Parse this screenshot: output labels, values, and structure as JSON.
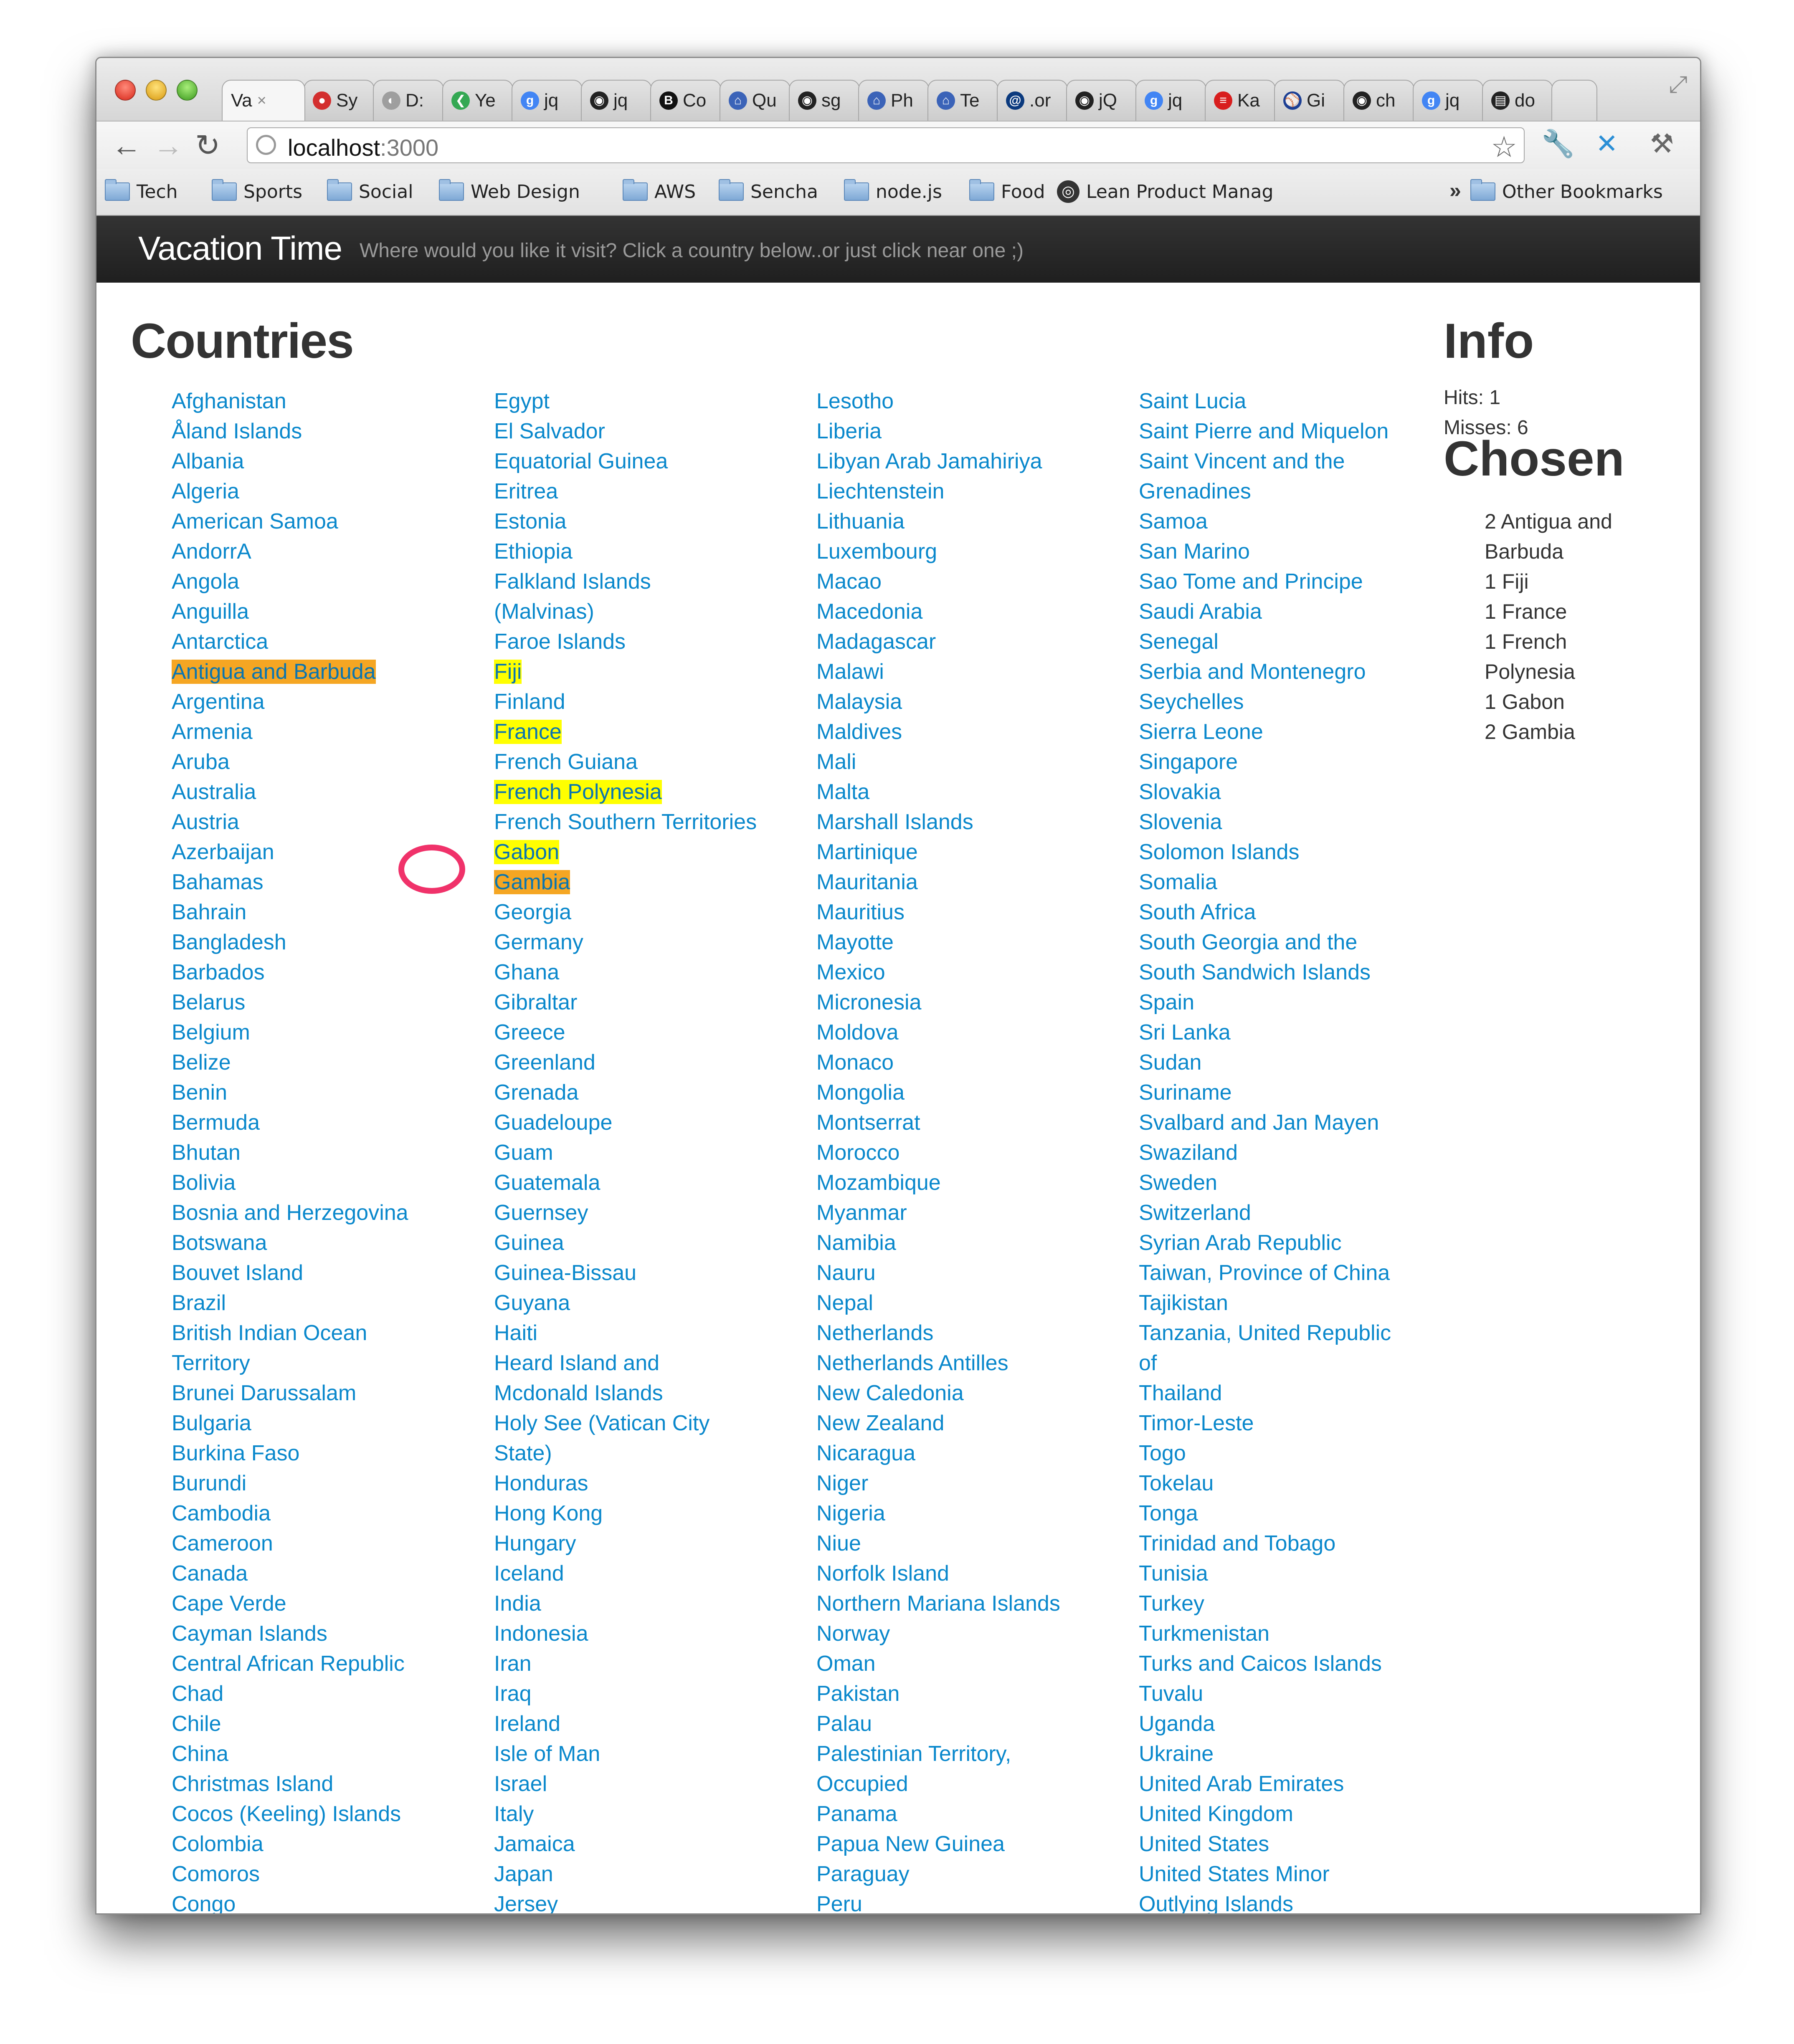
{
  "browser": {
    "tabs": [
      {
        "label": "Va",
        "icon": "page-icon",
        "color": "#f6f6f6",
        "active": true
      },
      {
        "label": "Sy",
        "icon": "red-dot-icon",
        "color": "#d32f2f"
      },
      {
        "label": "D:",
        "icon": "globe-icon",
        "color": "#9e9e9e"
      },
      {
        "label": "Ye",
        "icon": "chevrons-icon",
        "color": "#34a853"
      },
      {
        "label": "jq",
        "icon": "google-plus-icon",
        "color": "#4285f4"
      },
      {
        "label": "jq",
        "icon": "github-icon",
        "color": "#222222"
      },
      {
        "label": "Co",
        "icon": "b-icon",
        "color": "#111111"
      },
      {
        "label": "Qu",
        "icon": "house-icon",
        "color": "#3b63b8"
      },
      {
        "label": "sg",
        "icon": "github-icon",
        "color": "#222222"
      },
      {
        "label": "Ph",
        "icon": "house-icon",
        "color": "#3b63b8"
      },
      {
        "label": "Te",
        "icon": "house-icon",
        "color": "#3b63b8"
      },
      {
        "label": ".or",
        "icon": "swirl-icon",
        "color": "#0b3a7e"
      },
      {
        "label": "jQ",
        "icon": "github-icon",
        "color": "#222222"
      },
      {
        "label": "jq",
        "icon": "google-plus-icon",
        "color": "#4285f4"
      },
      {
        "label": "Ka",
        "icon": "flag-icon",
        "color": "#d81e1e"
      },
      {
        "label": "Gi",
        "icon": "mlb-icon",
        "color": "#1c3f94"
      },
      {
        "label": "ch",
        "icon": "github-icon",
        "color": "#222222"
      },
      {
        "label": "jq",
        "icon": "google-plus-icon",
        "color": "#4285f4"
      },
      {
        "label": "do",
        "icon": "doc-icon",
        "color": "#222222"
      }
    ],
    "address": {
      "host": "localhost",
      "port": ":3000"
    },
    "bookmarks": [
      {
        "label": "Tech",
        "type": "folder"
      },
      {
        "label": "Sports",
        "type": "folder"
      },
      {
        "label": "Social",
        "type": "folder"
      },
      {
        "label": "Web Design",
        "type": "folder"
      },
      {
        "label": "AWS",
        "type": "folder"
      },
      {
        "label": "Sencha",
        "type": "folder"
      },
      {
        "label": "node.js",
        "type": "folder"
      },
      {
        "label": "Food",
        "type": "folder"
      },
      {
        "label": "Lean Product Manag",
        "type": "link"
      }
    ],
    "more": "»",
    "other_bookmarks": "Other Bookmarks"
  },
  "app": {
    "title": "Vacation Time",
    "tagline": "Where would you like it visit? Click a country below..or just click near one ;)"
  },
  "countries": {
    "heading": "Countries",
    "columns": [
      [
        {
          "name": "Afghanistan"
        },
        {
          "name": "Åland Islands"
        },
        {
          "name": "Albania"
        },
        {
          "name": "Algeria"
        },
        {
          "name": "American Samoa"
        },
        {
          "name": "AndorrA"
        },
        {
          "name": "Angola"
        },
        {
          "name": "Anguilla"
        },
        {
          "name": "Antarctica"
        },
        {
          "name": "Antigua and Barbuda",
          "highlight": "orange"
        },
        {
          "name": "Argentina"
        },
        {
          "name": "Armenia"
        },
        {
          "name": "Aruba"
        },
        {
          "name": "Australia"
        },
        {
          "name": "Austria"
        },
        {
          "name": "Azerbaijan"
        },
        {
          "name": "Bahamas"
        },
        {
          "name": "Bahrain"
        },
        {
          "name": "Bangladesh"
        },
        {
          "name": "Barbados"
        },
        {
          "name": "Belarus"
        },
        {
          "name": "Belgium"
        },
        {
          "name": "Belize"
        },
        {
          "name": "Benin"
        },
        {
          "name": "Bermuda"
        },
        {
          "name": "Bhutan"
        },
        {
          "name": "Bolivia"
        },
        {
          "name": "Bosnia and Herzegovina"
        },
        {
          "name": "Botswana"
        },
        {
          "name": "Bouvet Island"
        },
        {
          "name": "Brazil"
        },
        {
          "name": "British Indian Ocean",
          "cont": "Territory"
        },
        {
          "name": "Brunei Darussalam"
        },
        {
          "name": "Bulgaria"
        },
        {
          "name": "Burkina Faso"
        },
        {
          "name": "Burundi"
        },
        {
          "name": "Cambodia"
        },
        {
          "name": "Cameroon"
        },
        {
          "name": "Canada"
        },
        {
          "name": "Cape Verde"
        },
        {
          "name": "Cayman Islands"
        },
        {
          "name": "Central African Republic"
        },
        {
          "name": "Chad"
        },
        {
          "name": "Chile"
        },
        {
          "name": "China"
        },
        {
          "name": "Christmas Island"
        },
        {
          "name": "Cocos (Keeling) Islands"
        },
        {
          "name": "Colombia"
        },
        {
          "name": "Comoros"
        },
        {
          "name": "Congo"
        }
      ],
      [
        {
          "name": "Egypt"
        },
        {
          "name": "El Salvador"
        },
        {
          "name": "Equatorial Guinea"
        },
        {
          "name": "Eritrea"
        },
        {
          "name": "Estonia"
        },
        {
          "name": "Ethiopia"
        },
        {
          "name": "Falkland Islands",
          "cont": "(Malvinas)"
        },
        {
          "name": "Faroe Islands"
        },
        {
          "name": "Fiji",
          "highlight": "yellow"
        },
        {
          "name": "Finland"
        },
        {
          "name": "France",
          "highlight": "yellow"
        },
        {
          "name": "French Guiana"
        },
        {
          "name": "French Polynesia",
          "highlight": "yellow"
        },
        {
          "name": "French Southern Territories"
        },
        {
          "name": "Gabon",
          "highlight": "yellow"
        },
        {
          "name": "Gambia",
          "highlight": "orange"
        },
        {
          "name": "Georgia"
        },
        {
          "name": "Germany"
        },
        {
          "name": "Ghana"
        },
        {
          "name": "Gibraltar"
        },
        {
          "name": "Greece"
        },
        {
          "name": "Greenland"
        },
        {
          "name": "Grenada"
        },
        {
          "name": "Guadeloupe"
        },
        {
          "name": "Guam"
        },
        {
          "name": "Guatemala"
        },
        {
          "name": "Guernsey"
        },
        {
          "name": "Guinea"
        },
        {
          "name": "Guinea-Bissau"
        },
        {
          "name": "Guyana"
        },
        {
          "name": "Haiti"
        },
        {
          "name": "Heard Island and",
          "cont": "Mcdonald Islands"
        },
        {
          "name": "Holy See (Vatican City",
          "cont": "State)"
        },
        {
          "name": "Honduras"
        },
        {
          "name": "Hong Kong"
        },
        {
          "name": "Hungary"
        },
        {
          "name": "Iceland"
        },
        {
          "name": "India"
        },
        {
          "name": "Indonesia"
        },
        {
          "name": "Iran"
        },
        {
          "name": "Iraq"
        },
        {
          "name": "Ireland"
        },
        {
          "name": "Isle of Man"
        },
        {
          "name": "Israel"
        },
        {
          "name": "Italy"
        },
        {
          "name": "Jamaica"
        },
        {
          "name": "Japan"
        },
        {
          "name": "Jersey"
        }
      ],
      [
        {
          "name": "Lesotho"
        },
        {
          "name": "Liberia"
        },
        {
          "name": "Libyan Arab Jamahiriya"
        },
        {
          "name": "Liechtenstein"
        },
        {
          "name": "Lithuania"
        },
        {
          "name": "Luxembourg"
        },
        {
          "name": "Macao"
        },
        {
          "name": "Macedonia"
        },
        {
          "name": "Madagascar"
        },
        {
          "name": "Malawi"
        },
        {
          "name": "Malaysia"
        },
        {
          "name": "Maldives"
        },
        {
          "name": "Mali"
        },
        {
          "name": "Malta"
        },
        {
          "name": "Marshall Islands"
        },
        {
          "name": "Martinique"
        },
        {
          "name": "Mauritania"
        },
        {
          "name": "Mauritius"
        },
        {
          "name": "Mayotte"
        },
        {
          "name": "Mexico"
        },
        {
          "name": "Micronesia"
        },
        {
          "name": "Moldova"
        },
        {
          "name": "Monaco"
        },
        {
          "name": "Mongolia"
        },
        {
          "name": "Montserrat"
        },
        {
          "name": "Morocco"
        },
        {
          "name": "Mozambique"
        },
        {
          "name": "Myanmar"
        },
        {
          "name": "Namibia"
        },
        {
          "name": "Nauru"
        },
        {
          "name": "Nepal"
        },
        {
          "name": "Netherlands"
        },
        {
          "name": "Netherlands Antilles"
        },
        {
          "name": "New Caledonia"
        },
        {
          "name": "New Zealand"
        },
        {
          "name": "Nicaragua"
        },
        {
          "name": "Niger"
        },
        {
          "name": "Nigeria"
        },
        {
          "name": "Niue"
        },
        {
          "name": "Norfolk Island"
        },
        {
          "name": "Northern Mariana Islands"
        },
        {
          "name": "Norway"
        },
        {
          "name": "Oman"
        },
        {
          "name": "Pakistan"
        },
        {
          "name": "Palau"
        },
        {
          "name": "Palestinian Territory,",
          "cont": "Occupied"
        },
        {
          "name": "Panama"
        },
        {
          "name": "Papua New Guinea"
        },
        {
          "name": "Paraguay"
        },
        {
          "name": "Peru"
        }
      ],
      [
        {
          "name": "Saint Lucia"
        },
        {
          "name": "Saint Pierre and Miquelon"
        },
        {
          "name": "Saint Vincent and the",
          "cont": "Grenadines"
        },
        {
          "name": "Samoa"
        },
        {
          "name": "San Marino"
        },
        {
          "name": "Sao Tome and Principe"
        },
        {
          "name": "Saudi Arabia"
        },
        {
          "name": "Senegal"
        },
        {
          "name": "Serbia and Montenegro"
        },
        {
          "name": "Seychelles"
        },
        {
          "name": "Sierra Leone"
        },
        {
          "name": "Singapore"
        },
        {
          "name": "Slovakia"
        },
        {
          "name": "Slovenia"
        },
        {
          "name": "Solomon Islands"
        },
        {
          "name": "Somalia"
        },
        {
          "name": "South Africa"
        },
        {
          "name": "South Georgia and the",
          "cont": "South Sandwich Islands"
        },
        {
          "name": "Spain"
        },
        {
          "name": "Sri Lanka"
        },
        {
          "name": "Sudan"
        },
        {
          "name": "Suriname"
        },
        {
          "name": "Svalbard and Jan Mayen"
        },
        {
          "name": "Swaziland"
        },
        {
          "name": "Sweden"
        },
        {
          "name": "Switzerland"
        },
        {
          "name": "Syrian Arab Republic"
        },
        {
          "name": "Taiwan, Province of China"
        },
        {
          "name": "Tajikistan"
        },
        {
          "name": "Tanzania, United Republic",
          "cont": "of"
        },
        {
          "name": "Thailand"
        },
        {
          "name": "Timor-Leste"
        },
        {
          "name": "Togo"
        },
        {
          "name": "Tokelau"
        },
        {
          "name": "Tonga"
        },
        {
          "name": "Trinidad and Tobago"
        },
        {
          "name": "Tunisia"
        },
        {
          "name": "Turkey"
        },
        {
          "name": "Turkmenistan"
        },
        {
          "name": "Turks and Caicos Islands"
        },
        {
          "name": "Tuvalu"
        },
        {
          "name": "Uganda"
        },
        {
          "name": "Ukraine"
        },
        {
          "name": "United Arab Emirates"
        },
        {
          "name": "United Kingdom"
        },
        {
          "name": "United States"
        },
        {
          "name": "United States Minor",
          "cont": "Outlying Islands"
        }
      ]
    ]
  },
  "info": {
    "heading": "Info",
    "hits": "Hits: 1",
    "misses": "Misses: 6"
  },
  "chosen": {
    "heading": "Chosen",
    "lines": [
      "2 Antigua and",
      "Barbuda",
      "1 Fiji",
      "1 France",
      "1 French",
      "Polynesia",
      "1 Gabon",
      "2 Gambia"
    ]
  },
  "colors": {
    "link": "#0a88cc",
    "highlight_yellow": "#ffff00",
    "highlight_orange": "#f5a623",
    "click_marker": "#f0326a",
    "header_bg": "#222222"
  }
}
